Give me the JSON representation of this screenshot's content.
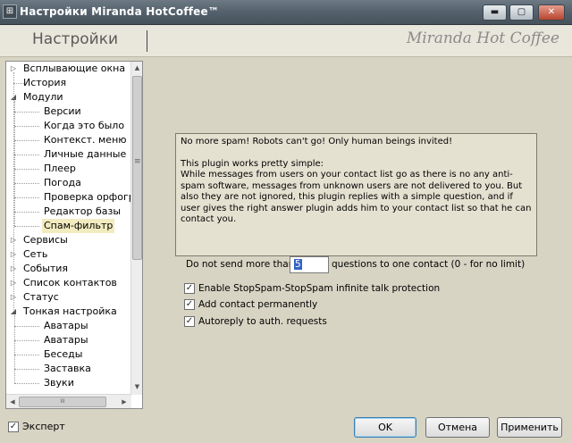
{
  "window": {
    "title": "Настройки Miranda HotCoffee™",
    "icon": "miranda-app-icon",
    "min_label": "▬",
    "max_label": "▢",
    "close_label": "✕"
  },
  "header": {
    "title": "Настройки",
    "logo": "Miranda Hot Coffee"
  },
  "tree": {
    "items": [
      {
        "label": "Всплывающие окна",
        "level": 0,
        "expander": "▷"
      },
      {
        "label": "История",
        "level": 0,
        "expander": ""
      },
      {
        "label": "Модули",
        "level": 0,
        "expander": "◢"
      },
      {
        "label": "Версии",
        "level": 1
      },
      {
        "label": "Когда это было",
        "level": 1
      },
      {
        "label": "Контекст. меню",
        "level": 1
      },
      {
        "label": "Личные данные",
        "level": 1
      },
      {
        "label": "Плеер",
        "level": 1
      },
      {
        "label": "Погода",
        "level": 1
      },
      {
        "label": "Проверка орфогра",
        "level": 1
      },
      {
        "label": "Редактор базы",
        "level": 1
      },
      {
        "label": "Спам-фильтр",
        "level": 1,
        "selected": true
      },
      {
        "label": "Сервисы",
        "level": 0,
        "expander": "▷"
      },
      {
        "label": "Сеть",
        "level": 0,
        "expander": "▷"
      },
      {
        "label": "События",
        "level": 0,
        "expander": "▷"
      },
      {
        "label": "Список контактов",
        "level": 0,
        "expander": "▷"
      },
      {
        "label": "Статус",
        "level": 0,
        "expander": "▷"
      },
      {
        "label": "Тонкая настройка",
        "level": 0,
        "expander": "◢"
      },
      {
        "label": "Аватары",
        "level": 1
      },
      {
        "label": "Аватары",
        "level": 1
      },
      {
        "label": "Беседы",
        "level": 1
      },
      {
        "label": "Заставка",
        "level": 1
      },
      {
        "label": "Звуки",
        "level": 1
      }
    ],
    "scroll_up": "▲",
    "scroll_down": "▼",
    "scroll_left": "◀",
    "scroll_right": "▶",
    "vthumb_grip": "≡",
    "hthumb_grip": "III"
  },
  "info": {
    "line1": "No more spam! Robots can't go! Only human beings invited!",
    "line2": "This plugin works pretty simple:",
    "line3": "While messages from users on your contact list go as there is no any anti-spam software, messages from unknown users are not delivered to you. But also they are not ignored, this plugin replies with a simple question, and if user gives the right answer plugin adds him to your contact list so that he can contact you."
  },
  "limit": {
    "prefix": "Do not send more than",
    "value": "5",
    "suffix": "questions to one contact (0 - for no limit)"
  },
  "options": [
    {
      "label": "Enable StopSpam-StopSpam infinite talk protection",
      "checked": true
    },
    {
      "label": "Add contact permanently",
      "checked": true
    },
    {
      "label": "Autoreply to auth. requests",
      "checked": true
    }
  ],
  "footer": {
    "expert_label": "Эксперт",
    "expert_checked": true,
    "ok": "OK",
    "cancel": "Отмена",
    "apply": "Применить"
  },
  "check_mark": "✓"
}
